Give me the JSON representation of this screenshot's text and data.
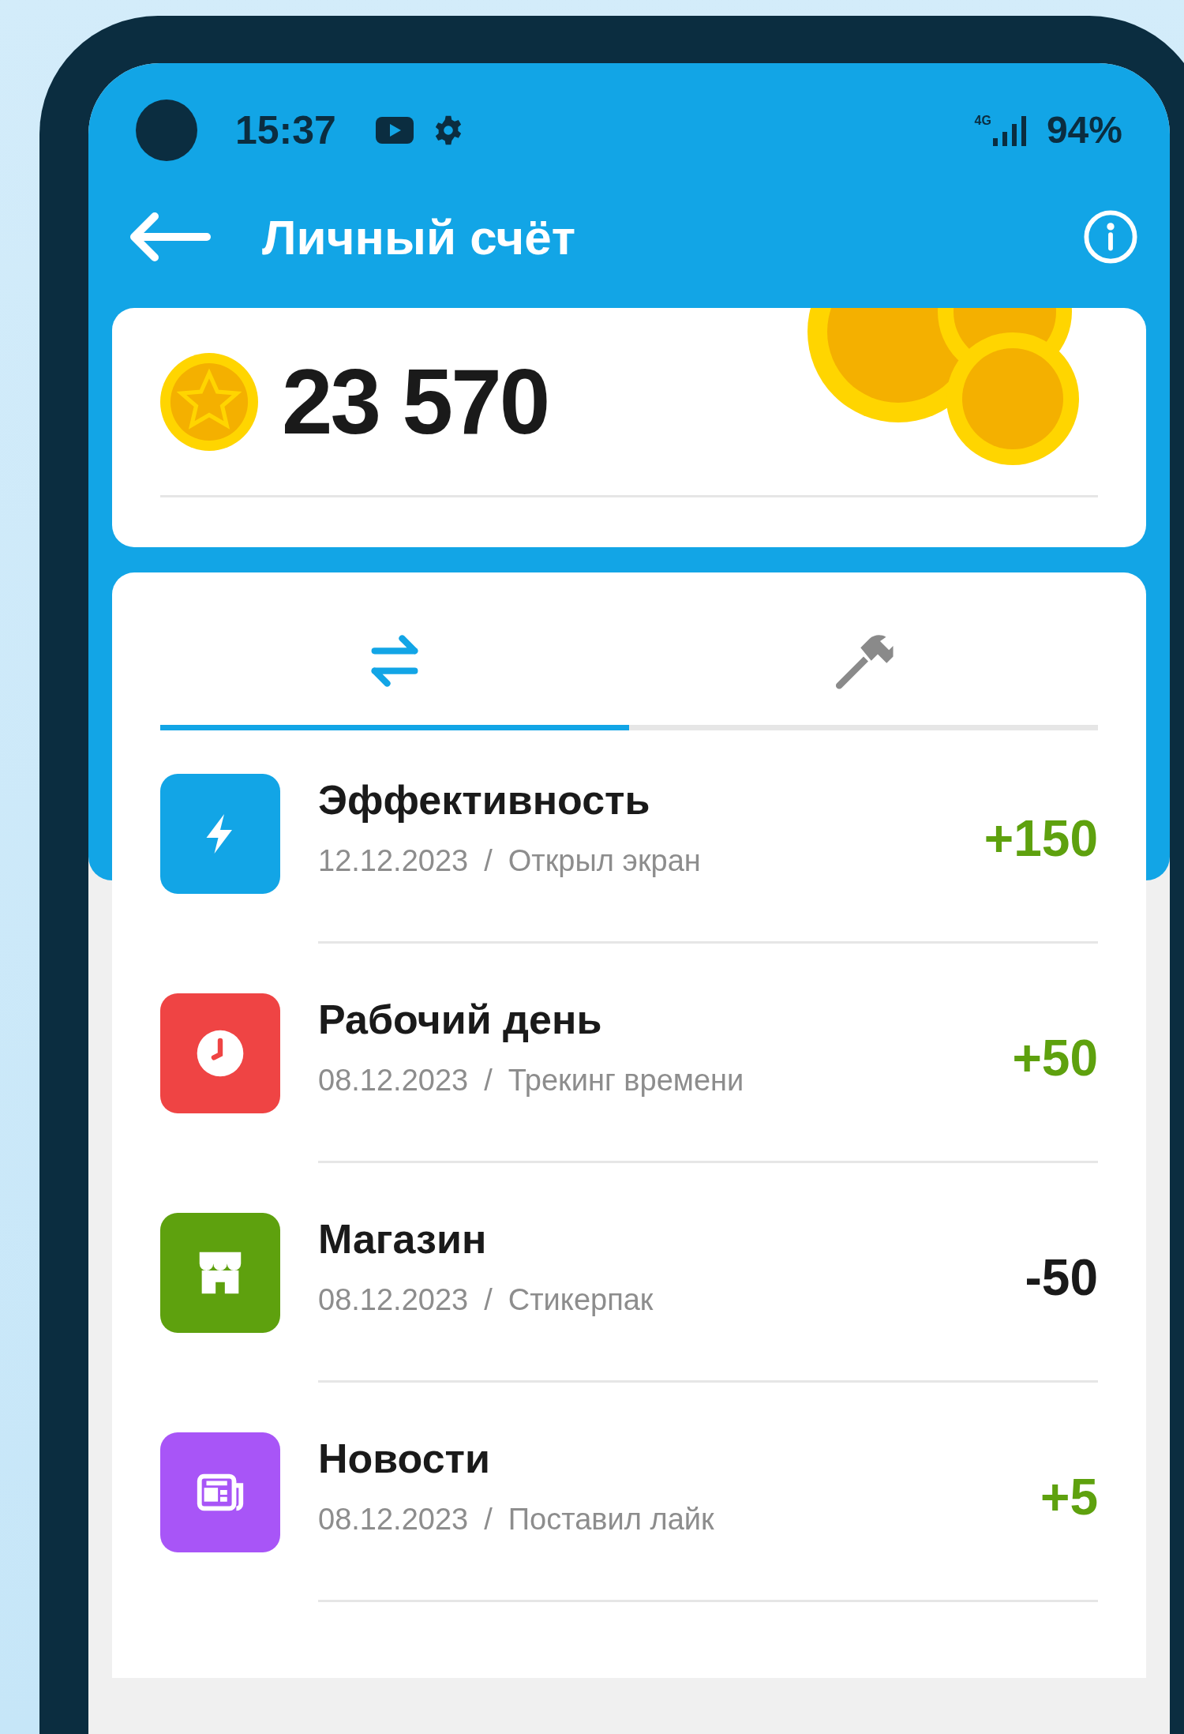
{
  "status_bar": {
    "time": "15:37",
    "network": "4G",
    "battery": "94%"
  },
  "header": {
    "title": "Личный счёт"
  },
  "balance": {
    "amount": "23 570"
  },
  "tabs": [
    {
      "kind": "transfers",
      "selected": true
    },
    {
      "kind": "tools",
      "selected": false
    }
  ],
  "transactions": [
    {
      "kind": "bolt",
      "color": "#12a5e6",
      "title": "Эффективность",
      "date": "12.12.2023",
      "separator": "/",
      "description": "Открыл экран",
      "amount": "+150",
      "positive": true
    },
    {
      "kind": "clock",
      "color": "#ef4444",
      "title": "Рабочий день",
      "date": "08.12.2023",
      "separator": "/",
      "description": "Трекинг времени",
      "amount": "+50",
      "positive": true
    },
    {
      "kind": "shop",
      "color": "#5ea10e",
      "title": "Магазин",
      "date": "08.12.2023",
      "separator": "/",
      "description": "Стикерпак",
      "amount": "-50",
      "positive": false
    },
    {
      "kind": "news",
      "color": "#a855f7",
      "title": "Новости",
      "date": "08.12.2023",
      "separator": "/",
      "description": "Поставил лайк",
      "amount": "+5",
      "positive": true
    }
  ]
}
